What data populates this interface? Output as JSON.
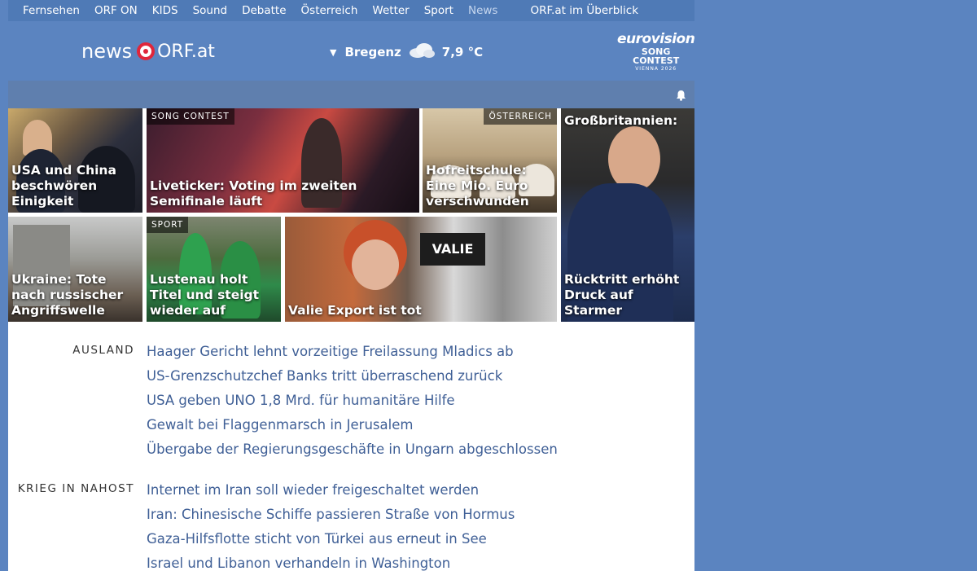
{
  "topnav": {
    "items": [
      "Fernsehen",
      "ORF ON",
      "KIDS",
      "Sound",
      "Debatte",
      "Österreich",
      "Wetter",
      "Sport",
      "News"
    ],
    "overview": "ORF.at im Überblick"
  },
  "logo": {
    "news": "news",
    "orf": "ORF.at"
  },
  "weather": {
    "city": "Bregenz",
    "temp": "7,9 °C"
  },
  "esc": {
    "line1": "eurovision",
    "line2": "SONG CONTEST",
    "line3": "VIENNA 2026"
  },
  "tiles": {
    "t1": {
      "headline": "USA und China beschwören Einigkeit"
    },
    "t2": {
      "label": "SONG CONTEST",
      "headline": "Liveticker: Voting im zweiten Semifinale läuft"
    },
    "t3": {
      "label": "ÖSTERREICH",
      "headline": "Hofreitschule: Eine Mio. Euro verschwunden"
    },
    "t4": {
      "headline_top": "Großbritannien:",
      "headline": "Rücktritt erhöht Druck auf Starmer"
    },
    "t5": {
      "headline": "Ukraine: Tote nach russischer Angriffswelle"
    },
    "t6": {
      "label": "SPORT",
      "headline": "Lustenau holt Titel und steigt wieder auf"
    },
    "t7": {
      "headline": "Valie Export ist tot",
      "sign": "VALIE"
    }
  },
  "sections": [
    {
      "name": "AUSLAND",
      "items": [
        "Haager Gericht lehnt vorzeitige Freilassung Mladics ab",
        "US-Grenzschutzchef Banks tritt überraschend zurück",
        "USA geben UNO 1,8 Mrd. für humanitäre Hilfe",
        "Gewalt bei Flaggenmarsch in Jerusalem",
        "Übergabe der Regierungsgeschäfte in Ungarn abgeschlossen"
      ]
    },
    {
      "name": "KRIEG IN NAHOST",
      "items": [
        "Internet im Iran soll wieder freigeschaltet werden",
        "Iran: Chinesische Schiffe passieren Straße von Hormus",
        "Gaza-Hilfsflotte sticht von Türkei aus erneut in See",
        "Israel und Libanon verhandeln in Washington"
      ]
    }
  ],
  "colors": {
    "background": "#5b84c0",
    "link": "#3f5f96",
    "brand_red": "#e0263b"
  }
}
